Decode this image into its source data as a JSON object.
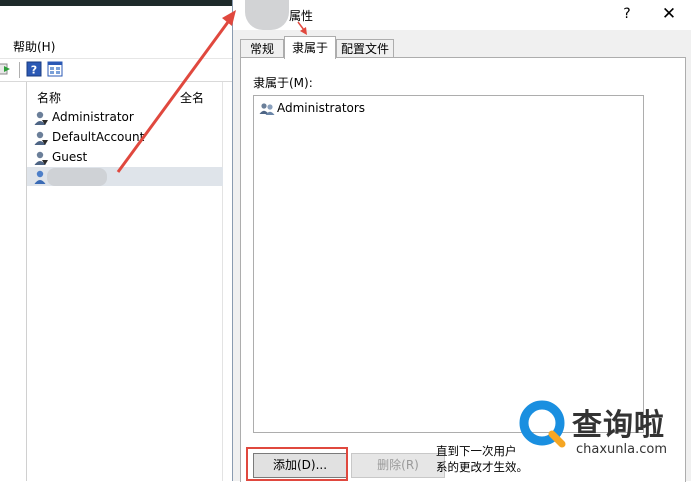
{
  "background_window": {
    "menu": {
      "help": "帮助(H)"
    },
    "list": {
      "columns": {
        "name": "名称",
        "full_name": "全名"
      },
      "users": [
        "Administrator",
        "DefaultAccount",
        "Guest"
      ]
    }
  },
  "dialog": {
    "title": "属性",
    "help_button": "?",
    "close_button": "✕",
    "tabs": {
      "general": "常规",
      "member_of": "隶属于",
      "profile": "配置文件"
    },
    "member_of_label": "隶属于(M):",
    "groups": [
      "Administrators"
    ],
    "add_button": "添加(D)...",
    "remove_button": "删除(R)",
    "note_line1": "直到下一次用户",
    "note_line2": "系的更改才生效。"
  },
  "watermark": {
    "chinese": "查询啦",
    "url": "chaxunla.com"
  },
  "colors": {
    "annotation_red": "#e0483e",
    "dialog_bg": "#f0f0f0",
    "watermark_blue": "#1a8fe0",
    "watermark_orange": "#f5a623"
  },
  "icons": {
    "user": "user-icon",
    "group": "group-icon",
    "help": "help-icon",
    "forward": "forward-icon"
  }
}
